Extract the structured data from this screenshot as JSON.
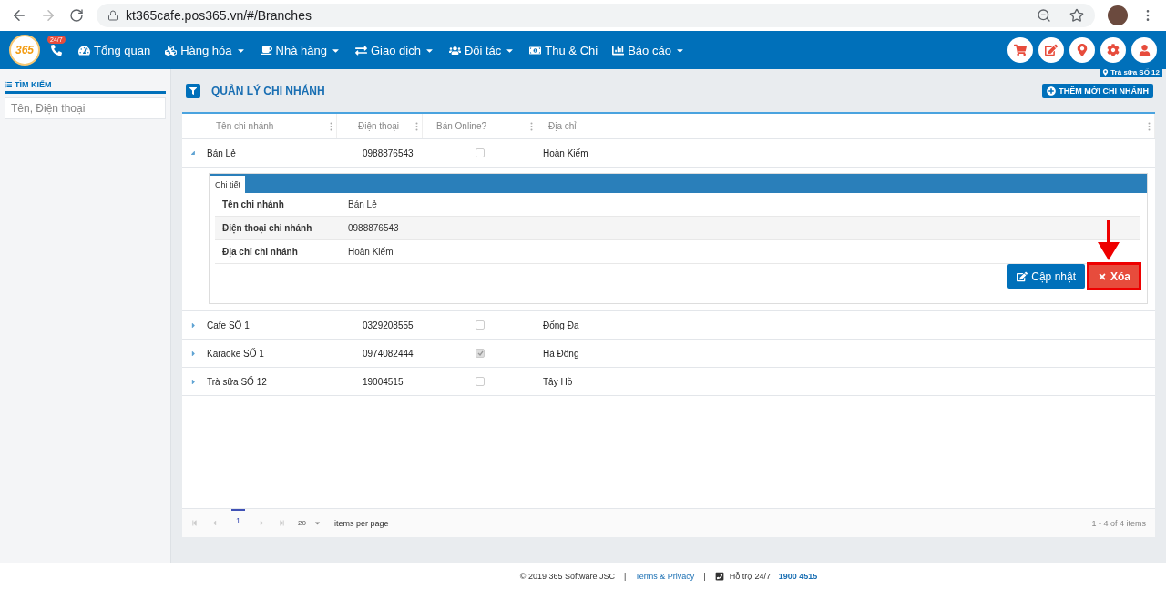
{
  "browser": {
    "url": "kt365cafe.pos365.vn/#/Branches"
  },
  "nav": {
    "logo": "365",
    "badge": "24/7",
    "items": [
      {
        "label": "Tổng quan",
        "dropdown": false
      },
      {
        "label": "Hàng hóa",
        "dropdown": true
      },
      {
        "label": "Nhà hàng",
        "dropdown": true
      },
      {
        "label": "Giao dịch",
        "dropdown": true
      },
      {
        "label": "Đối tác",
        "dropdown": true
      },
      {
        "label": "Thu & Chi",
        "dropdown": false
      },
      {
        "label": "Báo cáo",
        "dropdown": true
      }
    ],
    "location": "Trà sữa SỐ 12"
  },
  "sidebar": {
    "title": "TÌM KIẾM",
    "search": {
      "placeholder": "Tên, Điện thoại"
    }
  },
  "page": {
    "title": "QUẢN LÝ CHI NHÁNH",
    "add_button": "THÊM MỚI CHI NHÁNH"
  },
  "table": {
    "columns": [
      "Tên chi nhánh",
      "Điện thoại",
      "Bán Online?",
      "Địa chỉ"
    ],
    "rows": [
      {
        "name": "Bán Lẻ",
        "phone": "0988876543",
        "online": false,
        "address": "Hoàn Kiếm",
        "expanded": true,
        "detail": {
          "tab": "Chi tiết",
          "fields": [
            {
              "label": "Tên chi nhánh",
              "value": "Bán Lẻ"
            },
            {
              "label": "Điện thoại chi nhánh",
              "value": "0988876543"
            },
            {
              "label": "Địa chỉ chi nhánh",
              "value": "Hoàn Kiếm"
            }
          ],
          "update_button": "Cập nhật",
          "delete_button": "Xóa"
        }
      },
      {
        "name": "Cafe SỐ 1",
        "phone": "0329208555",
        "online": false,
        "address": "Đống Đa",
        "expanded": false
      },
      {
        "name": "Karaoke SỐ 1",
        "phone": "0974082444",
        "online": true,
        "address": "Hà Đông",
        "expanded": false
      },
      {
        "name": "Trà sữa SỐ 12",
        "phone": "19004515",
        "online": false,
        "address": "Tây Hồ",
        "expanded": false
      }
    ]
  },
  "pager": {
    "page": "1",
    "page_size": "20",
    "page_size_label": "items per page",
    "summary": "1 - 4 of 4 items"
  },
  "footer": {
    "copyright": "© 2019 365 Software JSC",
    "separators": [
      "|",
      "|"
    ],
    "link": "Terms & Privacy",
    "support_label": "Hỗ trợ 24/7:",
    "support_phone": "1900 4515"
  }
}
